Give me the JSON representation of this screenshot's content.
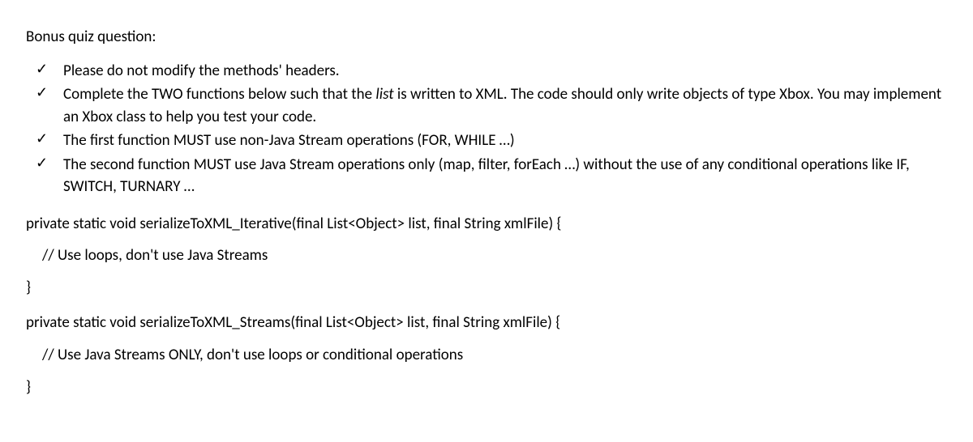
{
  "heading": "Bonus quiz question:",
  "check_glyph": "✓",
  "bullets": {
    "b1": "Please do not modify the methods' headers.",
    "b2_pre": "Complete the TWO functions below such that the ",
    "b2_italic": "list",
    "b2_post": " is written to XML. The code should only write objects of type Xbox. You may implement an Xbox class to help you test your code.",
    "b3": "The first function MUST use non-Java Stream operations (FOR, WHILE …)",
    "b4": "The second function MUST use Java Stream operations only (map, filter, forEach …) without the use of any conditional operations like IF, SWITCH, TURNARY …"
  },
  "code": {
    "fn1_sig": "private static void serializeToXML_Iterative(final List<Object> list, final String xmlFile) {",
    "fn1_comment": "// Use loops, don't use Java Streams",
    "close_brace1": "}",
    "fn2_sig": "private static void serializeToXML_Streams(final List<Object> list, final String xmlFile) {",
    "fn2_comment": "// Use Java Streams ONLY, don't use loops or conditional operations",
    "close_brace2": "}"
  }
}
